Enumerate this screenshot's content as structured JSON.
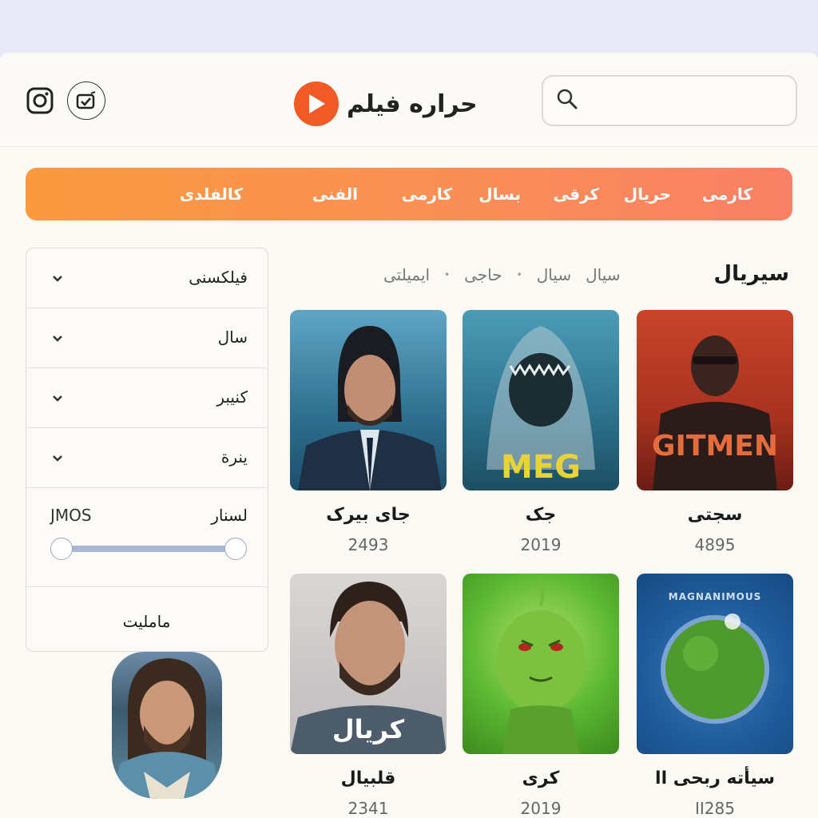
{
  "header": {
    "logo_text": "حراره فیلم",
    "search_placeholder": ""
  },
  "nav": {
    "items": [
      "كارمی",
      "حريال",
      "كرقی",
      "بسال",
      "كارمی",
      "الفنی",
      "كالفلدی"
    ]
  },
  "filters": {
    "rows": [
      "فيلكسنی",
      "سال",
      "كنيبر",
      "ينرة"
    ],
    "range_title": "لسنار",
    "range_value": "JMOS",
    "range_min": 0.0,
    "range_max": 1.0,
    "apply_label": "مامليت"
  },
  "section": {
    "title": "سيريال",
    "chips": [
      "سيال",
      "سيال",
      "حاجی",
      "ايميلتی"
    ]
  },
  "movies": [
    {
      "title": "جای بیرک",
      "year": "2493",
      "poster_text": ""
    },
    {
      "title": "جک",
      "year": "2019",
      "poster_text": "MEG"
    },
    {
      "title": "سجتی",
      "year": "4895",
      "poster_text": "GITMEN"
    },
    {
      "title": "قلبيال",
      "year": "2341",
      "poster_text": "كريال"
    },
    {
      "title": "كرى",
      "year": "2019",
      "poster_text": ""
    },
    {
      "title": "سیأته ربحی اا",
      "year": "II285",
      "poster_text": "MAGNANIMOUS"
    }
  ],
  "colors": {
    "accent": "#f15a24",
    "nav_start": "#f99a3e",
    "nav_end": "#f88065"
  }
}
